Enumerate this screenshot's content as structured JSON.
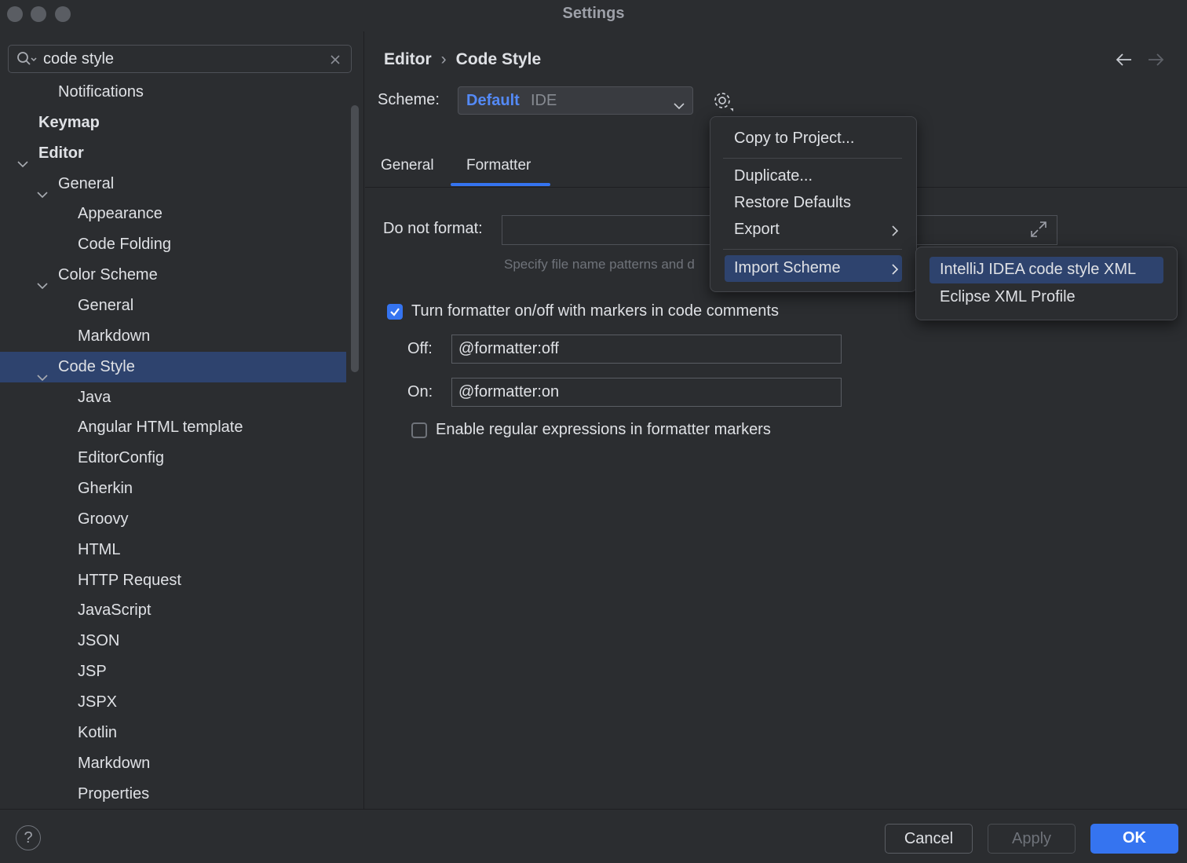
{
  "window": {
    "title": "Settings"
  },
  "search": {
    "value": "code style",
    "placeholder": ""
  },
  "sidebar": {
    "items": [
      {
        "label": "Notifications",
        "level": 2,
        "bold": false,
        "expanded": null
      },
      {
        "label": "Keymap",
        "level": 1,
        "bold": true,
        "expanded": null
      },
      {
        "label": "Editor",
        "level": 1,
        "bold": true,
        "expanded": true
      },
      {
        "label": "General",
        "level": 2,
        "bold": false,
        "expanded": true
      },
      {
        "label": "Appearance",
        "level": 3,
        "bold": false,
        "expanded": null
      },
      {
        "label": "Code Folding",
        "level": 3,
        "bold": false,
        "expanded": null
      },
      {
        "label": "Color Scheme",
        "level": 2,
        "bold": false,
        "expanded": true
      },
      {
        "label": "General",
        "level": 3,
        "bold": false,
        "expanded": null
      },
      {
        "label": "Markdown",
        "level": 3,
        "bold": false,
        "expanded": null
      },
      {
        "label": "Code Style",
        "level": 2,
        "bold": false,
        "expanded": true,
        "selected": true
      },
      {
        "label": "Java",
        "level": 3,
        "bold": false,
        "expanded": null
      },
      {
        "label": "Angular HTML template",
        "level": 3,
        "bold": false,
        "expanded": null
      },
      {
        "label": "EditorConfig",
        "level": 3,
        "bold": false,
        "expanded": null
      },
      {
        "label": "Gherkin",
        "level": 3,
        "bold": false,
        "expanded": null
      },
      {
        "label": "Groovy",
        "level": 3,
        "bold": false,
        "expanded": null
      },
      {
        "label": "HTML",
        "level": 3,
        "bold": false,
        "expanded": null
      },
      {
        "label": "HTTP Request",
        "level": 3,
        "bold": false,
        "expanded": null
      },
      {
        "label": "JavaScript",
        "level": 3,
        "bold": false,
        "expanded": null
      },
      {
        "label": "JSON",
        "level": 3,
        "bold": false,
        "expanded": null
      },
      {
        "label": "JSP",
        "level": 3,
        "bold": false,
        "expanded": null
      },
      {
        "label": "JSPX",
        "level": 3,
        "bold": false,
        "expanded": null
      },
      {
        "label": "Kotlin",
        "level": 3,
        "bold": false,
        "expanded": null
      },
      {
        "label": "Markdown",
        "level": 3,
        "bold": false,
        "expanded": null
      },
      {
        "label": "Properties",
        "level": 3,
        "bold": false,
        "expanded": null
      }
    ]
  },
  "breadcrumb": {
    "parent": "Editor",
    "separator": "›",
    "current": "Code Style"
  },
  "scheme": {
    "label": "Scheme:",
    "name": "Default",
    "type": "IDE"
  },
  "tabs": [
    {
      "label": "General"
    },
    {
      "label": "Formatter",
      "active": true
    }
  ],
  "formatter": {
    "do_not_format_label": "Do not format:",
    "do_not_format_value": "",
    "hint": "Specify file name patterns and d",
    "markers_checkbox_label": "Turn formatter on/off with markers in code comments",
    "markers_checked": true,
    "off_label": "Off:",
    "off_value": "@formatter:off",
    "on_label": "On:",
    "on_value": "@formatter:on",
    "regex_checkbox_label": "Enable regular expressions in formatter markers",
    "regex_checked": false
  },
  "gear_menu": {
    "items": [
      {
        "label": "Copy to Project..."
      },
      {
        "label": "Duplicate..."
      },
      {
        "label": "Restore Defaults"
      },
      {
        "label": "Export",
        "submenu": true
      },
      {
        "label": "Import Scheme",
        "submenu": true,
        "selected": true
      }
    ]
  },
  "import_submenu": {
    "items": [
      {
        "label": "IntelliJ IDEA code style XML",
        "selected": true
      },
      {
        "label": "Eclipse XML Profile"
      }
    ]
  },
  "footer": {
    "help": "?",
    "cancel": "Cancel",
    "apply": "Apply",
    "ok": "OK"
  },
  "colors": {
    "accent": "#3574f0",
    "selection": "#2e436e",
    "background": "#2b2d30",
    "scheme_name": "#548af7"
  }
}
